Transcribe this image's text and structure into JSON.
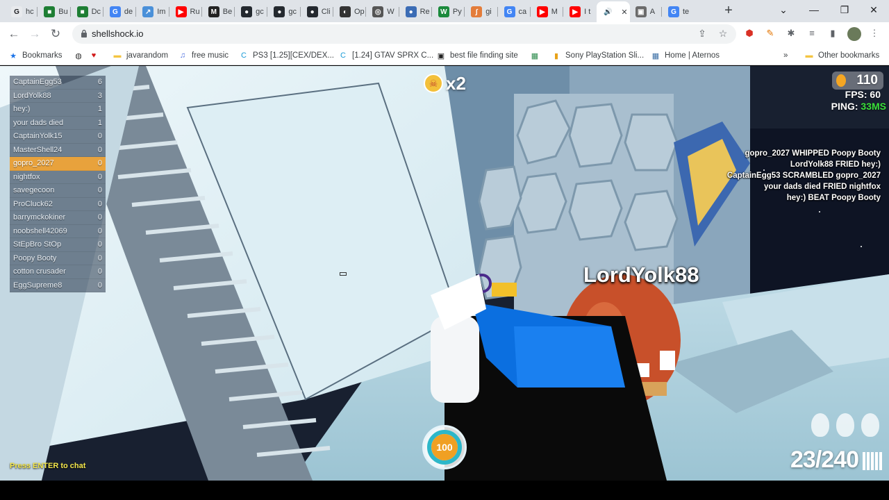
{
  "browser": {
    "tabs": [
      {
        "label": "hc",
        "color": "#e8eaed",
        "glyph": "G"
      },
      {
        "label": "Bu",
        "color": "#1e7e34",
        "glyph": "■"
      },
      {
        "label": "Dc",
        "color": "#1e7e34",
        "glyph": "■"
      },
      {
        "label": "de",
        "color": "#4285f4",
        "glyph": "G"
      },
      {
        "label": "Im",
        "color": "#4a90d9",
        "glyph": "↗"
      },
      {
        "label": "Ru",
        "color": "#ff0000",
        "glyph": "▶"
      },
      {
        "label": "Be",
        "color": "#222222",
        "glyph": "M"
      },
      {
        "label": "gc",
        "color": "#24292f",
        "glyph": "●"
      },
      {
        "label": "gc",
        "color": "#24292f",
        "glyph": "●"
      },
      {
        "label": "Cli",
        "color": "#24292f",
        "glyph": "●"
      },
      {
        "label": "Op",
        "color": "#333333",
        "glyph": "◐"
      },
      {
        "label": "W",
        "color": "#555555",
        "glyph": "◎"
      },
      {
        "label": "Re",
        "color": "#3b6cb5",
        "glyph": "●"
      },
      {
        "label": "Py",
        "color": "#1b8a3c",
        "glyph": "W"
      },
      {
        "label": "gi",
        "color": "#e37c3a",
        "glyph": "∫"
      },
      {
        "label": "ca",
        "color": "#4285f4",
        "glyph": "G"
      },
      {
        "label": "M",
        "color": "#ff0000",
        "glyph": "▶"
      },
      {
        "label": "I t",
        "color": "#ff0000",
        "glyph": "▶"
      },
      {
        "label": "",
        "color": "#ffffff",
        "glyph": "🔊",
        "active": true
      },
      {
        "label": "A",
        "color": "#6b6b6b",
        "glyph": "▣"
      },
      {
        "label": "te",
        "color": "#4285f4",
        "glyph": "G"
      }
    ],
    "url": "shellshock.io",
    "bookmarks": [
      {
        "label": "Bookmarks",
        "icon": "★",
        "color": "#1a73e8"
      },
      {
        "label": "",
        "icon": "◍",
        "color": "#333"
      },
      {
        "label": "",
        "icon": "♥",
        "color": "#d11a1a"
      },
      {
        "label": "javarandom",
        "icon": "▬",
        "color": "#f4c542"
      },
      {
        "label": "free music",
        "icon": "♫",
        "color": "#4a6ee0"
      },
      {
        "label": "PS3 [1.25][CEX/DEX...",
        "icon": "C",
        "color": "#1a9bd7"
      },
      {
        "label": "[1.24] GTAV SPRX C...",
        "icon": "C",
        "color": "#1a9bd7"
      },
      {
        "label": "best file finding site",
        "icon": "▣",
        "color": "#222"
      },
      {
        "label": "",
        "icon": "▦",
        "color": "#2a8a4a"
      },
      {
        "label": "Sony PlayStation Sli...",
        "icon": "▮",
        "color": "#e8a21a"
      },
      {
        "label": "Home | Aternos",
        "icon": "▦",
        "color": "#3a6ea5"
      }
    ],
    "other_bookmarks": "Other bookmarks",
    "overflow": "»"
  },
  "game": {
    "scoreboard": [
      {
        "name": "CaptainEgg53",
        "score": "6",
        "me": false
      },
      {
        "name": "LordYolk88",
        "score": "3",
        "me": false
      },
      {
        "name": "hey:)",
        "score": "1",
        "me": false
      },
      {
        "name": "your dads died",
        "score": "1",
        "me": false
      },
      {
        "name": "CaptainYolk15",
        "score": "0",
        "me": false
      },
      {
        "name": "MasterShell24",
        "score": "0",
        "me": false
      },
      {
        "name": "gopro_2027",
        "score": "0",
        "me": true
      },
      {
        "name": "nightfox",
        "score": "0",
        "me": false
      },
      {
        "name": "savegecoon",
        "score": "0",
        "me": false
      },
      {
        "name": "ProCluck62",
        "score": "0",
        "me": false
      },
      {
        "name": "barrymckokiner",
        "score": "0",
        "me": false
      },
      {
        "name": "noobshell42069",
        "score": "0",
        "me": false
      },
      {
        "name": "StEpBro StOp",
        "score": "0",
        "me": false
      },
      {
        "name": "Poopy Booty",
        "score": "0",
        "me": false
      },
      {
        "name": "cotton crusader",
        "score": "0",
        "me": false
      },
      {
        "name": "EggSupreme8",
        "score": "0",
        "me": false
      }
    ],
    "eggs": "110",
    "fps_label": "FPS: 60",
    "ping_label": "PING:",
    "ping_value": "33MS",
    "killfeed": [
      "gopro_2027 WHIPPED Poopy Booty",
      "LordYolk88 FRIED hey:)",
      "CaptainEgg53 SCRAMBLED gopro_2027",
      "your dads died FRIED nightfox",
      "hey:) BEAT Poopy Booty"
    ],
    "streak": "x2",
    "enemy_name": "LordYolk88",
    "health": "100",
    "health_fraction": 1.0,
    "ammo": "23/240",
    "grenades": 3,
    "chat_hint": "Press ENTER to chat"
  }
}
